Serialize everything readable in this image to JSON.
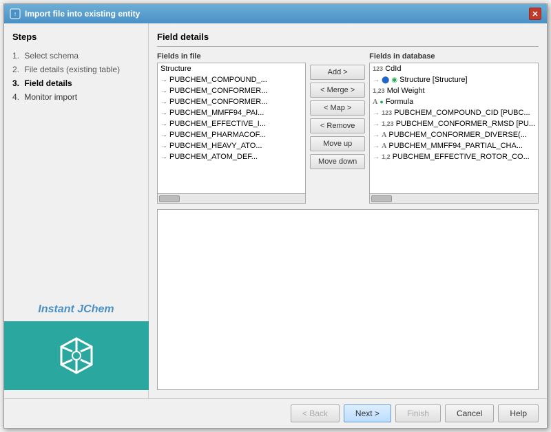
{
  "dialog": {
    "title": "Import file into existing entity"
  },
  "close_button": "✕",
  "steps": {
    "title": "Steps",
    "items": [
      {
        "number": "1.",
        "label": "Select schema",
        "state": "completed"
      },
      {
        "number": "2.",
        "label": "File details (existing table)",
        "state": "completed"
      },
      {
        "number": "3.",
        "label": "Field details",
        "state": "active"
      },
      {
        "number": "4.",
        "label": "Monitor import",
        "state": "normal"
      }
    ]
  },
  "brand": {
    "text": "Instant JChem"
  },
  "main": {
    "title": "Field details",
    "fields_in_file": {
      "label": "Fields in file",
      "items": [
        {
          "text": "Structure",
          "icon": ""
        },
        {
          "text": "PUBCHEM_COMPOUND_...",
          "icon": "→"
        },
        {
          "text": "PUBCHEM_CONFORMER...",
          "icon": "→"
        },
        {
          "text": "PUBCHEM_CONFORMER...",
          "icon": "→"
        },
        {
          "text": "PUBCHEM_MMFF94_PAI...",
          "icon": "→"
        },
        {
          "text": "PUBCHEM_EFFECTIVE_I...",
          "icon": "→"
        },
        {
          "text": "PUBCHEM_PHARMACOF...",
          "icon": "→"
        },
        {
          "text": "PUBCHEM_HEAVY_ATO...",
          "icon": "→"
        },
        {
          "text": "PUBCHEM_ATOM_DEF...",
          "icon": "→"
        }
      ]
    },
    "buttons": [
      {
        "label": "Add >",
        "id": "add",
        "enabled": true
      },
      {
        "label": "< Merge >",
        "id": "merge",
        "enabled": true
      },
      {
        "label": "< Map >",
        "id": "map",
        "enabled": true
      },
      {
        "label": "< Remove",
        "id": "remove",
        "enabled": true
      },
      {
        "label": "Move up",
        "id": "move-up",
        "enabled": true
      },
      {
        "label": "Move down",
        "id": "move-down",
        "enabled": true
      }
    ],
    "fields_in_database": {
      "label": "Fields in database",
      "items": [
        {
          "text": "CdId",
          "type": "123",
          "arrow": "",
          "icon_type": "num"
        },
        {
          "text": "Structure [Structure]",
          "type": "",
          "arrow": "→",
          "icon_type": "struct"
        },
        {
          "text": "Mol Weight",
          "type": "1,23",
          "arrow": "",
          "icon_type": "num"
        },
        {
          "text": "Formula",
          "type": "A",
          "arrow": "",
          "icon_type": "text"
        },
        {
          "text": "PUBCHEM_COMPOUND_CID [PUBC...",
          "type": "123",
          "arrow": "→",
          "icon_type": "num"
        },
        {
          "text": "PUBCHEM_CONFORMER_RMSD [PU...",
          "type": "",
          "arrow": "→",
          "icon_type": "num"
        },
        {
          "text": "PUBCHEM_CONFORMER_DIVERSE(...",
          "type": "A",
          "arrow": "→",
          "icon_type": "text"
        },
        {
          "text": "PUBCHEM_MMFF94_PARTIAL_CHA...",
          "type": "A",
          "arrow": "→",
          "icon_type": "text"
        },
        {
          "text": "PUBCHEM_EFFECTIVE_ROTOR_CO...",
          "type": "1,2",
          "arrow": "→",
          "icon_type": "num"
        }
      ]
    }
  },
  "bottom_buttons": [
    {
      "label": "< Back",
      "id": "back",
      "enabled": false
    },
    {
      "label": "Next >",
      "id": "next",
      "enabled": true,
      "primary": true
    },
    {
      "label": "Finish",
      "id": "finish",
      "enabled": false
    },
    {
      "label": "Cancel",
      "id": "cancel",
      "enabled": true
    },
    {
      "label": "Help",
      "id": "help",
      "enabled": true
    }
  ]
}
